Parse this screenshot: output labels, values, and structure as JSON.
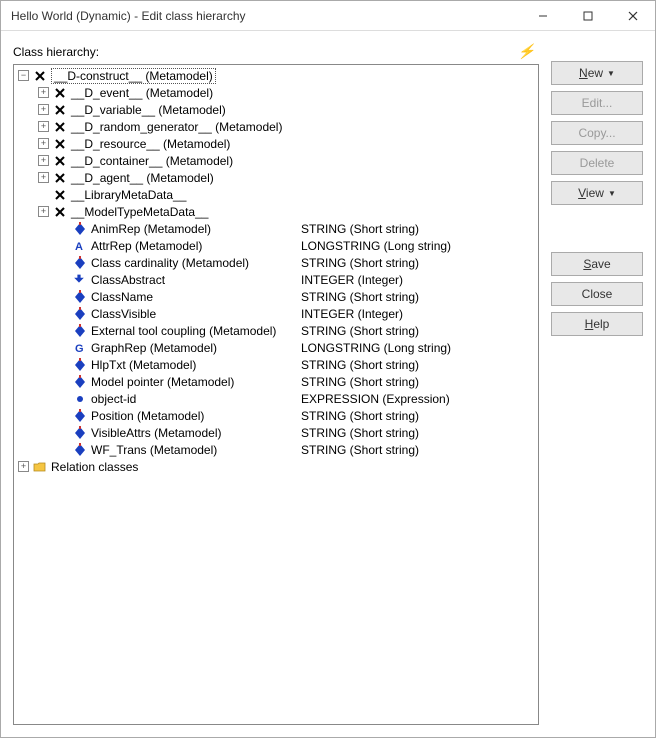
{
  "window": {
    "title": "Hello World (Dynamic) - Edit class hierarchy"
  },
  "label": "Class hierarchy:",
  "buttons": {
    "new": "New",
    "edit": "Edit...",
    "copy": "Copy...",
    "delete": "Delete",
    "view": "View",
    "save": "Save",
    "close": "Close",
    "help": "Help"
  },
  "tree": {
    "root": {
      "label": "__D-construct__ (Metamodel)",
      "selected": true,
      "expanded": true,
      "icon": "abstract"
    },
    "children_lvl1": [
      {
        "label": "__D_event__ (Metamodel)",
        "icon": "abstract",
        "expandable": true
      },
      {
        "label": "__D_variable__ (Metamodel)",
        "icon": "abstract",
        "expandable": true
      },
      {
        "label": "__D_random_generator__ (Metamodel)",
        "icon": "abstract",
        "expandable": true
      },
      {
        "label": "__D_resource__ (Metamodel)",
        "icon": "abstract",
        "expandable": true
      },
      {
        "label": "__D_container__ (Metamodel)",
        "icon": "abstract",
        "expandable": true
      },
      {
        "label": "__D_agent__ (Metamodel)",
        "icon": "abstract",
        "expandable": true
      },
      {
        "label": "__LibraryMetaData__",
        "icon": "abstract",
        "expandable": false
      },
      {
        "label": "__ModelTypeMetaData__",
        "icon": "abstract",
        "expandable": true
      }
    ],
    "attrs": [
      {
        "label": "AnimRep (Metamodel)",
        "type": "STRING (Short string)",
        "icon": "attr"
      },
      {
        "label": "AttrRep (Metamodel)",
        "type": "LONGSTRING (Long string)",
        "icon": "attr-a"
      },
      {
        "label": "Class cardinality (Metamodel)",
        "type": "STRING (Short string)",
        "icon": "attr"
      },
      {
        "label": "ClassAbstract",
        "type": "INTEGER (Integer)",
        "icon": "attr-down"
      },
      {
        "label": "ClassName",
        "type": "STRING (Short string)",
        "icon": "attr"
      },
      {
        "label": "ClassVisible",
        "type": "INTEGER (Integer)",
        "icon": "attr"
      },
      {
        "label": "External tool coupling (Metamodel)",
        "type": "STRING (Short string)",
        "icon": "attr"
      },
      {
        "label": "GraphRep (Metamodel)",
        "type": "LONGSTRING (Long string)",
        "icon": "attr-g"
      },
      {
        "label": "HlpTxt (Metamodel)",
        "type": "STRING (Short string)",
        "icon": "attr"
      },
      {
        "label": "Model pointer (Metamodel)",
        "type": "STRING (Short string)",
        "icon": "attr"
      },
      {
        "label": "object-id",
        "type": "EXPRESSION (Expression)",
        "icon": "attr-dot"
      },
      {
        "label": "Position (Metamodel)",
        "type": "STRING (Short string)",
        "icon": "attr"
      },
      {
        "label": "VisibleAttrs (Metamodel)",
        "type": "STRING (Short string)",
        "icon": "attr"
      },
      {
        "label": "WF_Trans (Metamodel)",
        "type": "STRING (Short string)",
        "icon": "attr"
      }
    ],
    "relation": {
      "label": "Relation classes",
      "icon": "folder"
    }
  }
}
